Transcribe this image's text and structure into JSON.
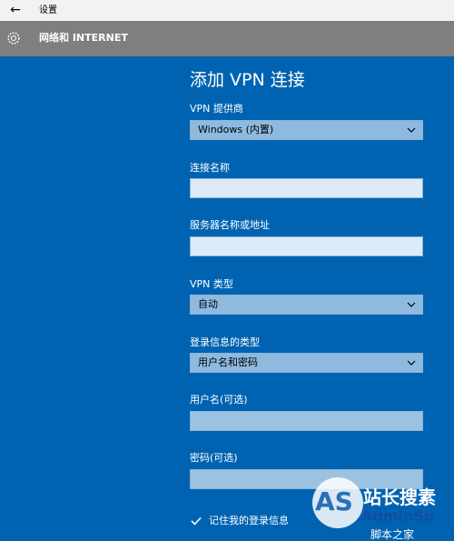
{
  "titlebar": {
    "back_icon": "back-arrow-icon",
    "title": "设置"
  },
  "header": {
    "icon": "gear-icon",
    "title": "网络和 INTERNET"
  },
  "form": {
    "title": "添加 VPN 连接",
    "provider_label": "VPN 提供商",
    "provider_value": "Windows (内置)",
    "connection_name_label": "连接名称",
    "connection_name_value": "",
    "server_label": "服务器名称或地址",
    "server_value": "",
    "vpn_type_label": "VPN 类型",
    "vpn_type_value": "自动",
    "sign_in_type_label": "登录信息的类型",
    "sign_in_type_value": "用户名和密码",
    "username_label": "用户名(可选)",
    "username_value": "",
    "password_label": "密码(可选)",
    "password_value": "",
    "remember_label": "记住我的登录信息",
    "remember_checked": true
  },
  "watermark": {
    "logo": "AS",
    "line1": "站长搜素",
    "line2": "AdminSo",
    "line3": "脚本之家"
  },
  "colors": {
    "background": "#0063b1",
    "header": "#7f7f7f",
    "titlebar": "#f2f2f2"
  }
}
